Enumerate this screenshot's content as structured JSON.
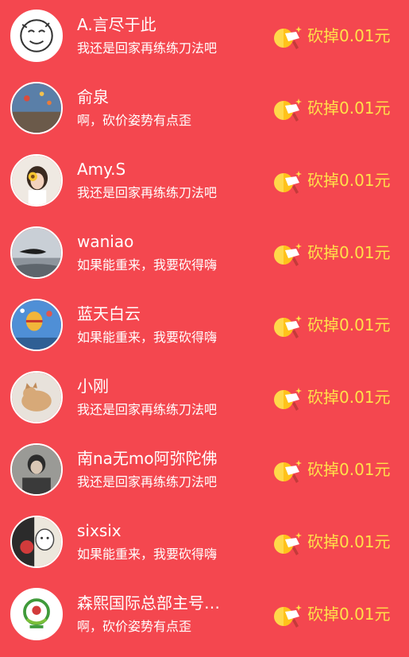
{
  "colors": {
    "background": "#f4474f",
    "name_text": "#ffffff",
    "message_text": "#ffffff",
    "amount_text": "#ffe14a"
  },
  "entries": [
    {
      "name": "A.言尽于此",
      "message": "我还是回家再练练刀法吧",
      "amount": "砍掉0.01元",
      "avatar": "doodle-face-avatar"
    },
    {
      "name": "俞泉",
      "message": "啊，砍价姿势有点歪",
      "amount": "砍掉0.01元",
      "avatar": "balloon-landscape-avatar"
    },
    {
      "name": "Amy.S",
      "message": "我还是回家再练练刀法吧",
      "amount": "砍掉0.01元",
      "avatar": "girl-sunflower-avatar"
    },
    {
      "name": "waniao",
      "message": "如果能重来，我要砍得嗨",
      "amount": "砍掉0.01元",
      "avatar": "hand-sky-avatar"
    },
    {
      "name": "蓝天白云",
      "message": "如果能重来，我要砍得嗨",
      "amount": "砍掉0.01元",
      "avatar": "hot-air-balloons-avatar"
    },
    {
      "name": "小刚",
      "message": "我还是回家再练练刀法吧",
      "amount": "砍掉0.01元",
      "avatar": "cat-avatar"
    },
    {
      "name": "南na无mo阿弥陀佛",
      "message": "我还是回家再练练刀法吧",
      "amount": "砍掉0.01元",
      "avatar": "person-photo-avatar"
    },
    {
      "name": "sixsix",
      "message": "如果能重来，我要砍得嗨",
      "amount": "砍掉0.01元",
      "avatar": "cartoon-rose-avatar"
    },
    {
      "name": "森熙国际总部主号…",
      "message": "啊，砍价姿势有点歪",
      "amount": "砍掉0.01元",
      "avatar": "green-logo-avatar"
    }
  ]
}
